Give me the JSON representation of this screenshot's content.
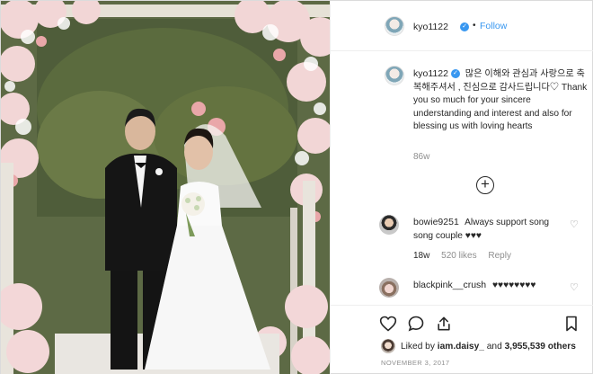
{
  "post": {
    "image_alt": "wedding photo",
    "author": {
      "username": "kyo1122",
      "verified_icon": "verified-badge-icon",
      "follow_label": "Follow",
      "separator": "•"
    },
    "caption": {
      "username": "kyo1122",
      "text": "많은 이해와 관심과 사랑으로 축복해주셔서 , 진심으로 감사드립니다♡ Thank you so much for your sincere understanding and interest and also for blessing us with loving hearts",
      "time_ago": "86w"
    },
    "load_more_label": "+",
    "comments": [
      {
        "username": "bowie9251",
        "text": "Always support song song couple ♥♥♥",
        "time": "18w",
        "likes": "520 likes",
        "reply": "Reply",
        "heart_icon": "♡"
      },
      {
        "username": "blackpink__crush",
        "text": "♥♥♥♥♥♥♥♥",
        "heart_icon": "♡"
      }
    ],
    "actions": {
      "like_icon": "heart-outline-icon",
      "comment_icon": "comment-bubble-icon",
      "share_icon": "share-arrow-icon",
      "save_icon": "bookmark-icon"
    },
    "liked_by": {
      "prefix": "Liked by",
      "user": "iam.daisy_",
      "and": "and",
      "others": "3,955,539 others"
    },
    "date": "NOVEMBER 3, 2017"
  },
  "colors": {
    "link_blue": "#3897f0",
    "muted_text": "#8e8e8e",
    "border": "#efefef"
  }
}
